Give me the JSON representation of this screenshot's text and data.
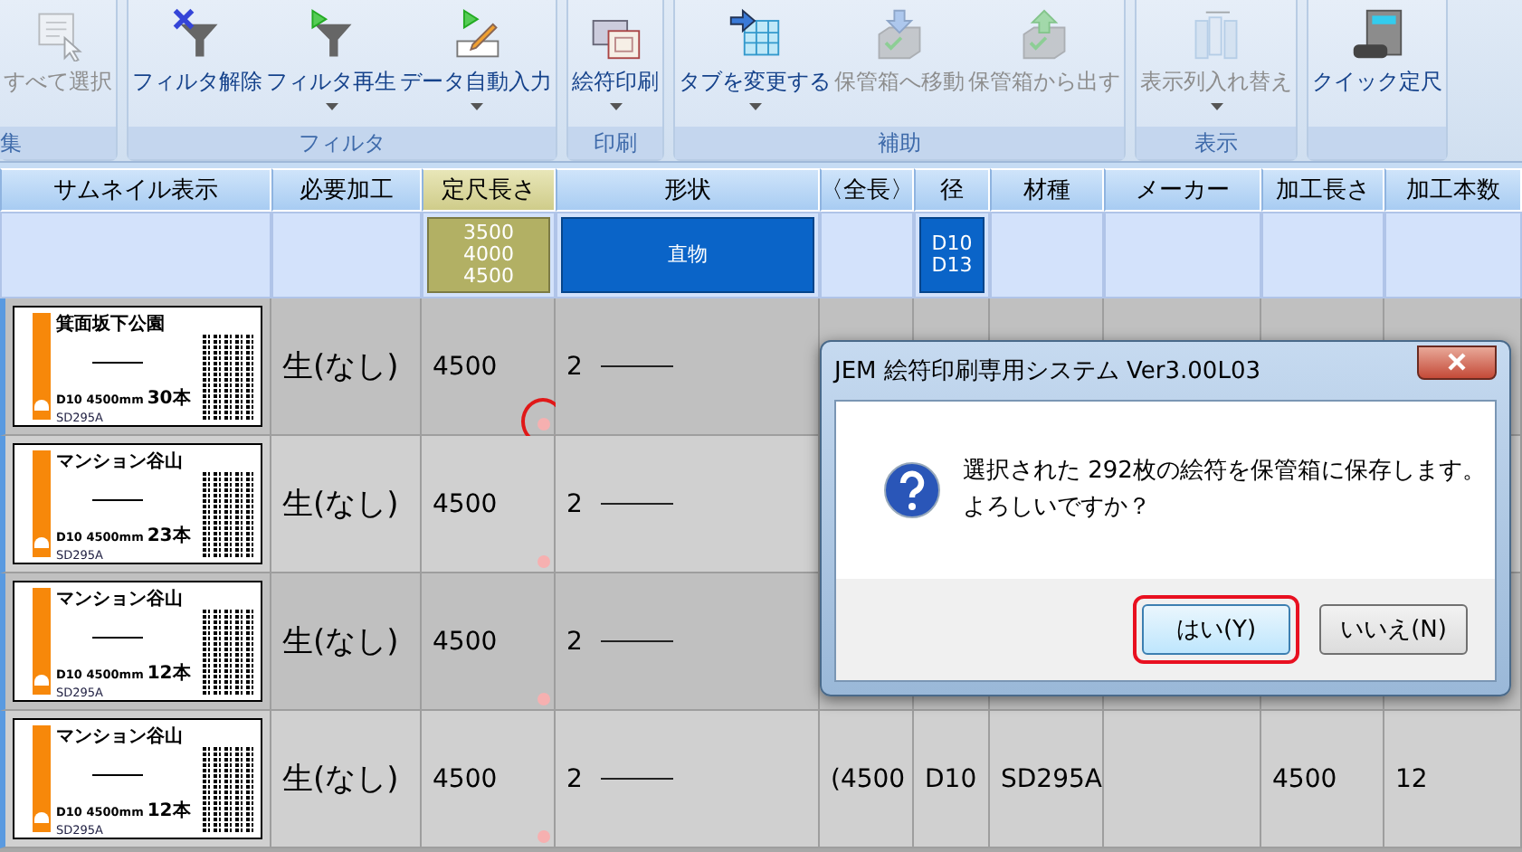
{
  "ribbon": {
    "groups": [
      {
        "label": "集",
        "buttons": [
          {
            "label": "すべて選択",
            "kind": "select",
            "disabled": true,
            "dropdown": false
          }
        ]
      },
      {
        "label": "フィルタ",
        "buttons": [
          {
            "label": "フィルタ解除",
            "kind": "filter-clear",
            "disabled": false,
            "dropdown": false
          },
          {
            "label": "フィルタ再生",
            "kind": "filter-play",
            "disabled": false,
            "dropdown": true
          },
          {
            "label": "データ自動入力",
            "kind": "auto-input",
            "disabled": false,
            "dropdown": true
          }
        ]
      },
      {
        "label": "印刷",
        "buttons": [
          {
            "label": "絵符印刷",
            "kind": "print",
            "disabled": false,
            "dropdown": true
          }
        ]
      },
      {
        "label": "補助",
        "buttons": [
          {
            "label": "タブを変更する",
            "kind": "tab-change",
            "disabled": false,
            "dropdown": true
          },
          {
            "label": "保管箱へ移動",
            "kind": "box-in",
            "disabled": true,
            "dropdown": false
          },
          {
            "label": "保管箱から出す",
            "kind": "box-out",
            "disabled": true,
            "dropdown": false
          }
        ]
      },
      {
        "label": "表示",
        "buttons": [
          {
            "label": "表示列入れ替え",
            "kind": "columns",
            "disabled": true,
            "dropdown": true
          }
        ]
      },
      {
        "buttons": [
          {
            "label": "クイック定尺",
            "kind": "calculator",
            "disabled": false,
            "dropdown": false
          }
        ]
      }
    ]
  },
  "table": {
    "columns": [
      {
        "label": "サムネイル表示"
      },
      {
        "label": "必要加工"
      },
      {
        "label": "定尺長さ",
        "filter": "3500\n4000\n4500",
        "color": "#b2b064"
      },
      {
        "label": "形状",
        "filter": "直物",
        "color": "#0a64c8"
      },
      {
        "label": "〈全長〉"
      },
      {
        "label": "径",
        "filter": "D10\nD13",
        "color": "#0a64c8"
      },
      {
        "label": "材種"
      },
      {
        "label": "メーカー"
      },
      {
        "label": "加工長さ"
      },
      {
        "label": "加工本数"
      }
    ],
    "rows": [
      {
        "marked": true,
        "circled": true,
        "cells": [
          {
            "title": "箕面坂下公園",
            "spec": "D10 4500mm",
            "count": "30本",
            "material": "SD295A"
          },
          "生(なし)",
          "4500",
          "2"
        ]
      },
      {
        "marked": true,
        "circled": false,
        "cells": [
          {
            "title": "マンション谷山",
            "spec": "D10 4500mm",
            "count": "23本",
            "material": "SD295A"
          },
          "生(なし)",
          "4500",
          "2"
        ]
      },
      {
        "marked": true,
        "circled": false,
        "cells": [
          {
            "title": "マンション谷山",
            "spec": "D10 4500mm",
            "count": "12本",
            "material": "SD295A"
          },
          "生(なし)",
          "4500",
          "2"
        ]
      },
      {
        "marked": true,
        "circled": false,
        "cells": [
          {
            "title": "マンション谷山",
            "spec": "D10 4500mm",
            "count": "12本",
            "material": "SD295A"
          },
          "生(なし)",
          "4500",
          "2",
          "(4500",
          "D10",
          "SD295A",
          "",
          "4500",
          "12"
        ]
      }
    ]
  },
  "dialog": {
    "title": "JEM 絵符印刷専用システム Ver3.00L03",
    "message": [
      "選択された 292枚の絵符を保管箱に保存します。",
      "よろしいですか？"
    ],
    "buttons": [
      {
        "label": "はい(Y)",
        "default": true,
        "highlighted": true
      },
      {
        "label": "いいえ(N)",
        "default": false,
        "highlighted": false
      }
    ]
  }
}
